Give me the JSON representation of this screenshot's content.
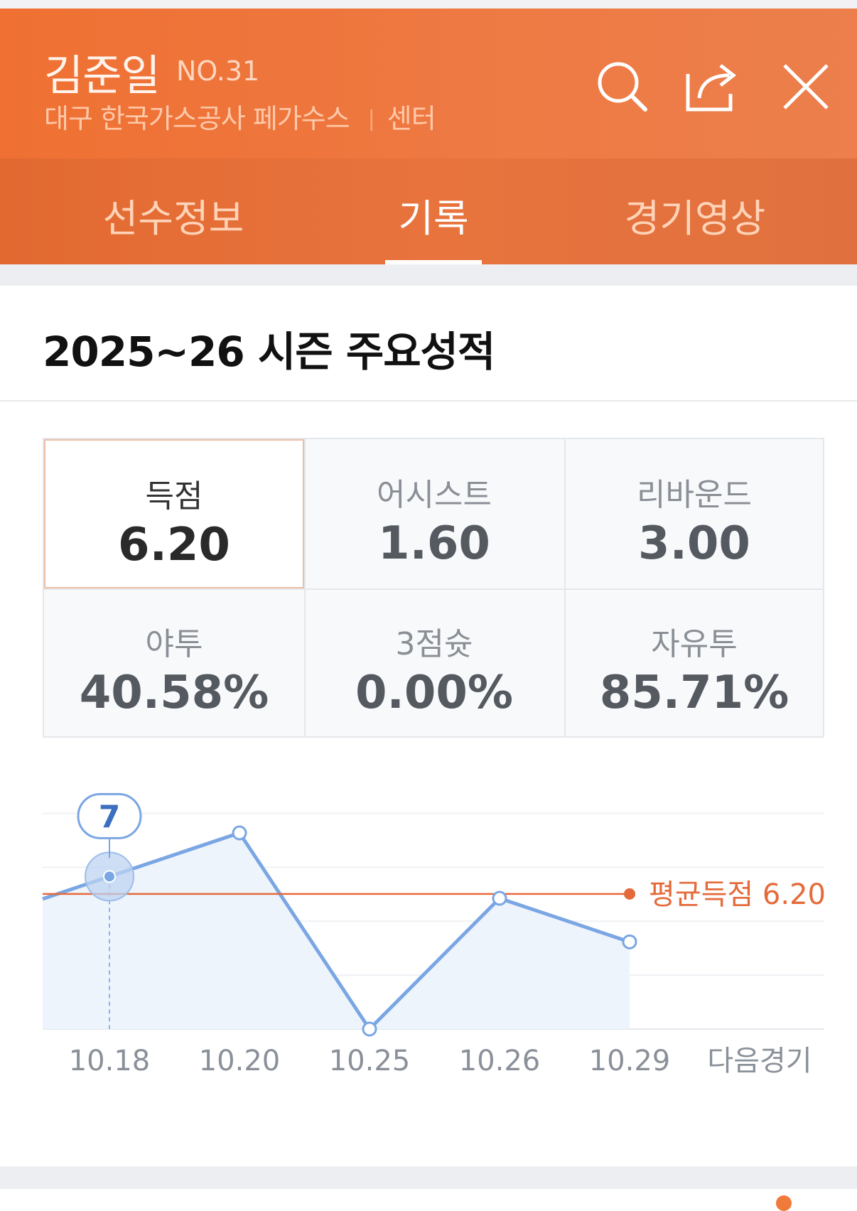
{
  "player": {
    "name": "김준일",
    "number": "NO.31",
    "team": "대구 한국가스공사 페가수스",
    "separator": "|",
    "position": "센터"
  },
  "header_icons": [
    "search-icon",
    "share-icon",
    "close-icon"
  ],
  "tabs": [
    {
      "label": "선수정보",
      "active": false
    },
    {
      "label": "기록",
      "active": true
    },
    {
      "label": "경기영상",
      "active": false
    }
  ],
  "season": {
    "title": "2025~26 시즌 주요성적"
  },
  "stats": [
    {
      "label": "득점",
      "value": "6.20",
      "selected": true
    },
    {
      "label": "어시스트",
      "value": "1.60",
      "selected": false
    },
    {
      "label": "리바운드",
      "value": "3.00",
      "selected": false
    },
    {
      "label": "야투",
      "value": "40.58%",
      "selected": false
    },
    {
      "label": "3점슛",
      "value": "0.00%",
      "selected": false
    },
    {
      "label": "자유투",
      "value": "85.71%",
      "selected": false
    }
  ],
  "colors": {
    "accent": "#ef7032",
    "series_line": "#7aa6e3",
    "average_line": "#e56a3a",
    "tooltip_text": "#3c6fc0"
  },
  "chart_data": {
    "type": "line",
    "categories": [
      "10.18",
      "10.20",
      "10.25",
      "10.26",
      "10.29",
      "다음경기"
    ],
    "series": [
      {
        "values": [
          7,
          9,
          0,
          6,
          4,
          null
        ]
      }
    ],
    "average": {
      "label": "평균득점 6.20",
      "value": 6.2
    },
    "tooltip": {
      "category": "10.18",
      "value": "7"
    },
    "ylim": [
      0,
      12
    ],
    "grid": true
  }
}
